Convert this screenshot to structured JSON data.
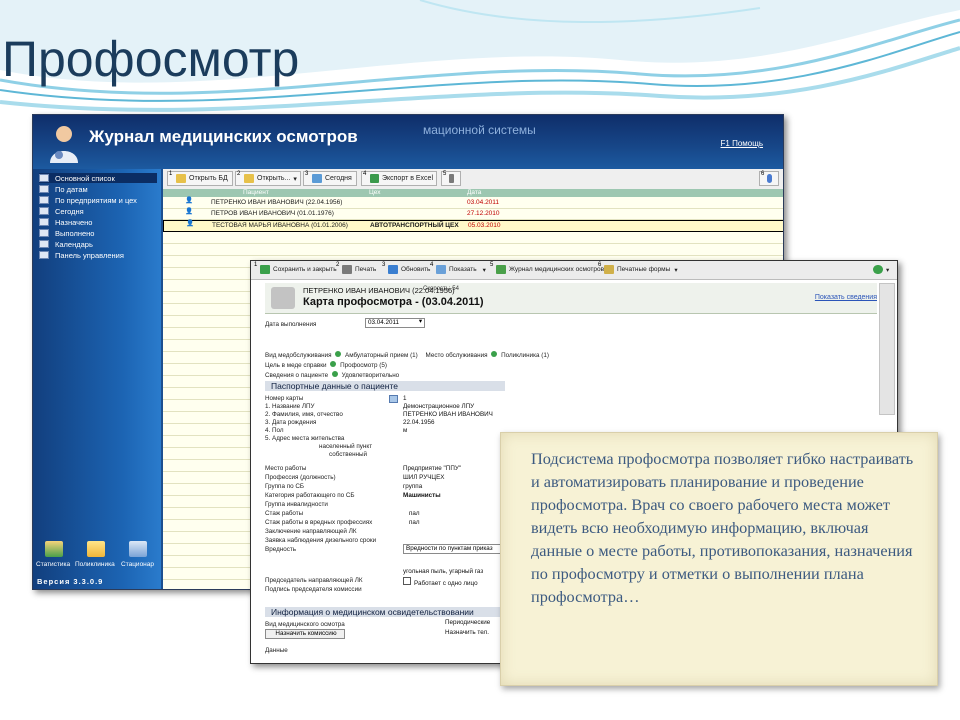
{
  "slide": {
    "title": "Профосмотр"
  },
  "journal": {
    "title": "Журнал медицинских осмотров",
    "subtitle_partial": "мационной системы",
    "help": "F1 Помощь",
    "sidebar": [
      {
        "label": "Основной список",
        "selected": true
      },
      {
        "label": "По датам"
      },
      {
        "label": "По предприятиям и цех"
      },
      {
        "label": "Сегодня"
      },
      {
        "label": "Назначено"
      },
      {
        "label": "Выполнено"
      },
      {
        "label": "Календарь"
      },
      {
        "label": "Панель управления"
      }
    ],
    "bottom_icons": [
      {
        "label": "Статистика",
        "icon": "statistics-icon"
      },
      {
        "label": "Поликлиника",
        "icon": "folder-icon"
      },
      {
        "label": "Стационар",
        "icon": "hospital-icon"
      }
    ],
    "version": "Версия 3.3.0.9",
    "toolbar": [
      {
        "num": "1",
        "label": "Открыть БД",
        "icon": "open-db-icon"
      },
      {
        "num": "2",
        "label": "Открыть...",
        "icon": "open-icon"
      },
      {
        "num": "3",
        "label": "Сегодня",
        "icon": "today-icon"
      },
      {
        "num": "4",
        "label": "Экспорт в Excel",
        "icon": "excel-icon"
      },
      {
        "num": "5",
        "label": "",
        "icon": "print-icon"
      },
      {
        "num": "6",
        "label": "",
        "icon": "help-icon"
      }
    ],
    "columns": [
      "Пациент",
      "Цех",
      "Дата"
    ],
    "rows": [
      {
        "patient": "ПЕТРЕНКО ИВАН ИВАНОВИЧ (22.04.1956)",
        "shop": "",
        "date": "03.04.2011"
      },
      {
        "patient": "ПЕТРОВ ИВАН ИВАНОВИЧ (01.01.1976)",
        "shop": "",
        "date": "27.12.2010"
      },
      {
        "patient": "ТЕСТОВАЯ МАРЬЯ ИВАНОВНА (01.01.2006)",
        "shop": "АВТОТРАНСПОРТНЫЙ ЦЕХ",
        "date": "05.03.2010",
        "selected": true
      }
    ]
  },
  "card": {
    "toolbar": [
      {
        "num": "1",
        "label": "Сохранить и закрыть",
        "icon": "save-icon"
      },
      {
        "num": "2",
        "label": "Печать",
        "icon": "print-icon"
      },
      {
        "num": "3",
        "label": "Обновить",
        "icon": "refresh-icon"
      },
      {
        "num": "4",
        "label": "Показать",
        "icon": "show-icon"
      },
      {
        "num": "5",
        "label": "Журнал медицинских осмотров",
        "icon": "journal-icon"
      },
      {
        "num": "6",
        "label": "Печатные формы",
        "icon": "forms-icon"
      }
    ],
    "patient": "ПЕТРЕНКО ИВАН ИВАНОВИЧ (22.04.1956)",
    "patient_status": "Скорость: 54",
    "title": "Карта профосмотра - (03.04.2011)",
    "show_info": "Показать сведения",
    "date_label": "Дата выполнения",
    "date_value": "03.04.2011",
    "service_line": {
      "label": "Вид медобслуживания",
      "value": "Амбулаторный прием (1)",
      "place_label": "Место обслуживания",
      "place_value": "Поликлиника (1)"
    },
    "goal_line": {
      "label": "Цель в меде справки",
      "value": "Профосмотр (5)"
    },
    "resident_line": {
      "label": "Сведения о пациенте",
      "value": "Удовлетворительно"
    },
    "section_passport": "Паспортные данные о пациенте",
    "passport": [
      {
        "label": "Номер карты",
        "value": "1"
      },
      {
        "label": "1. Название ЛПУ",
        "value": "Демонстрационное ЛПУ"
      },
      {
        "label": "2. Фамилия, имя, отчество",
        "value": "ПЕТРЕНКО ИВАН ИВАНОВИЧ"
      },
      {
        "label": "3. Дата рождения",
        "value": "22.04.1956"
      },
      {
        "label": "4. Пол",
        "value": "м"
      },
      {
        "label": "5. Адрес места жительства",
        "value": ""
      },
      {
        "label": "населенный пункт",
        "value": ""
      },
      {
        "label": "собственный",
        "value": ""
      }
    ],
    "work": [
      {
        "label": "Место работы",
        "value": "Предприятие \"ППУ\""
      },
      {
        "label": "Профессия (должность)",
        "value": "ШИЛ РУЧЦЕХ"
      },
      {
        "label": "Группа по СБ",
        "value": "группа"
      },
      {
        "label": "Категория работающего по СБ",
        "value": "Машинисты"
      },
      {
        "label": "Группа инвалидности",
        "value": ""
      },
      {
        "label": "Стаж работы",
        "value": "пал"
      },
      {
        "label": "Стаж работы в вредных профессиях",
        "value": "пал"
      },
      {
        "label": "Заключение направляющей ЛК",
        "value": ""
      },
      {
        "label": "Заявка наблюдения дизельного сроки",
        "value": ""
      },
      {
        "label": "Вредность",
        "value": "Вредности по пунктам приказ"
      }
    ],
    "extra": [
      {
        "label": "Председатель направляющей ЛК",
        "value": "угольная пыль, угарный газ"
      },
      {
        "label": "Подпись председателя комиссии",
        "value": "Работает с одно лицо"
      }
    ],
    "section_medical": "Информация о медицинском освидетельствовании",
    "medical": [
      {
        "label": "Вид медицинского осмотра",
        "value": "Периодические"
      },
      {
        "label": "Назначить комиссию",
        "value": "Назначить тел."
      },
      {
        "label": "Данные",
        "value": ""
      }
    ]
  },
  "note": {
    "text": "Подсистема профосмотра позволяет гибко настраивать и автоматизировать планирование и проведение профосмотра. Врач со своего рабочего места может видеть всю необходимую информацию, включая данные о месте работы, противопоказания, назначения по профосмотру и отметки о выполнении плана профосмотра…"
  },
  "colors": {
    "title": "#1b3c5c",
    "window_blue": "#1b4f90",
    "note_bg": "#f7f2d5",
    "note_text": "#3c5a80",
    "date_red": "#c00000"
  }
}
